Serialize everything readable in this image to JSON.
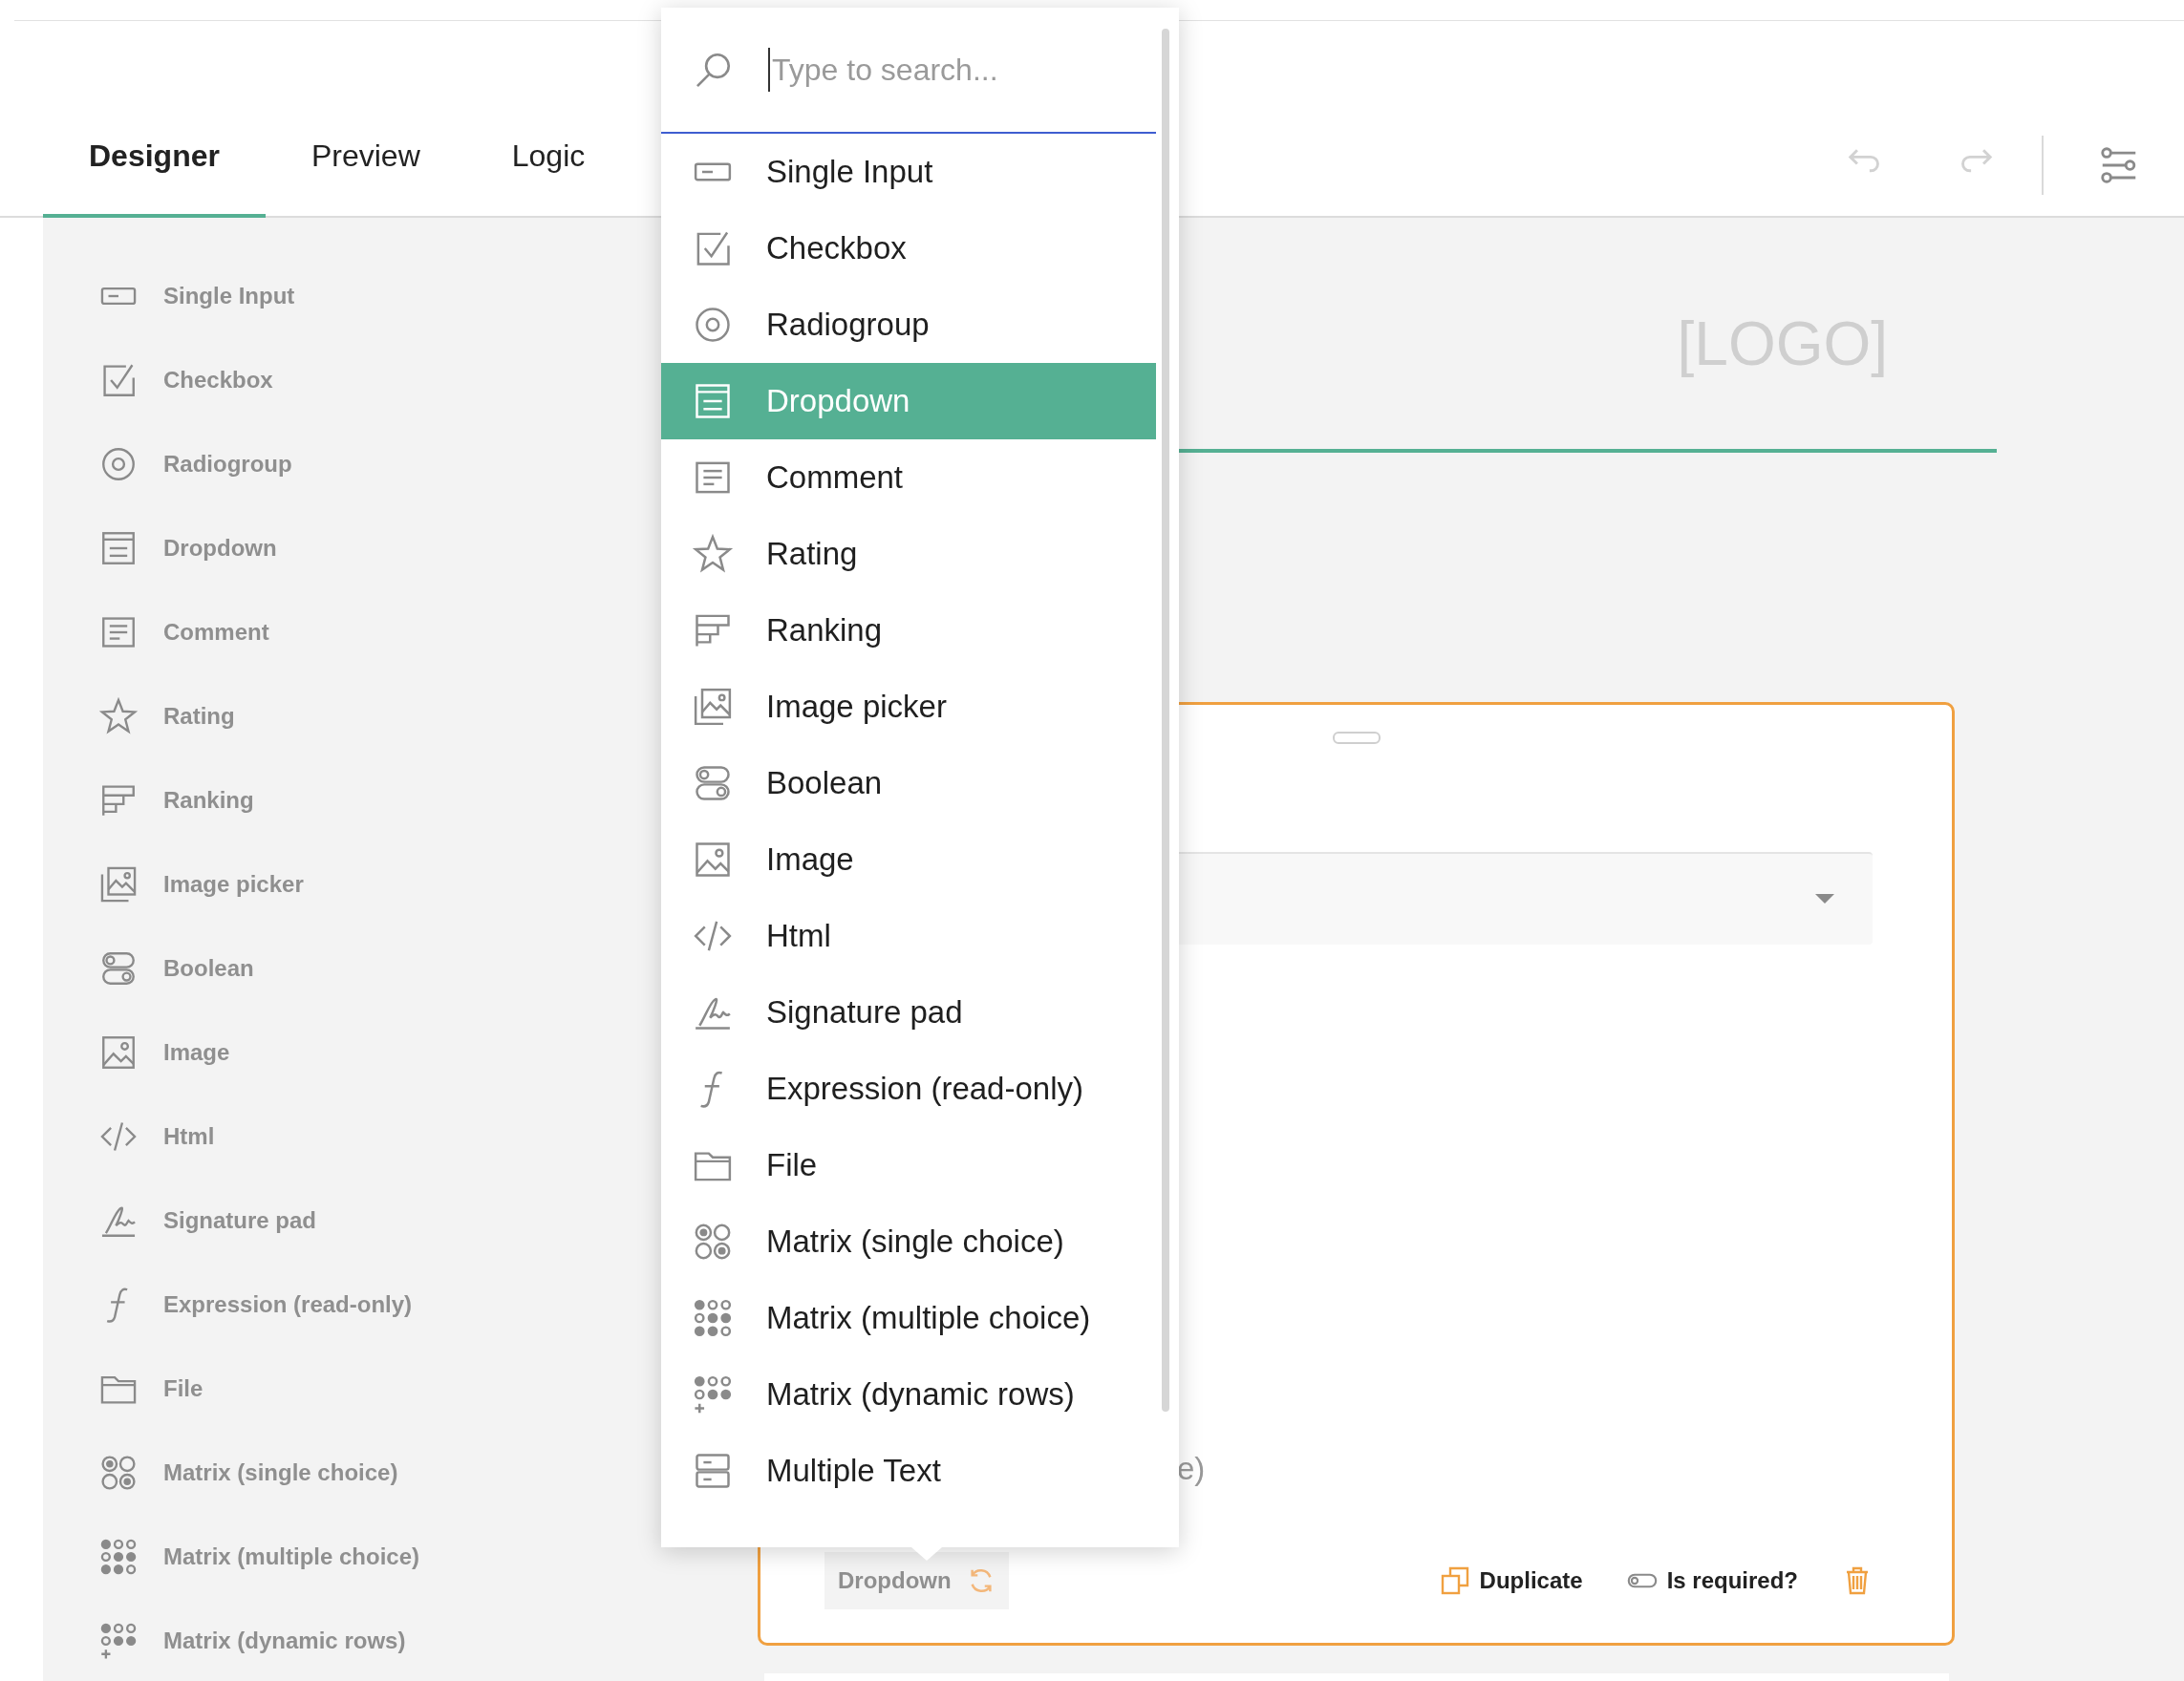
{
  "tabs": [
    {
      "label": "Designer",
      "selected": true
    },
    {
      "label": "Preview",
      "selected": false
    },
    {
      "label": "Logic",
      "selected": false
    }
  ],
  "toolbar": [
    {
      "kind": "undo",
      "disabled": true
    },
    {
      "kind": "redo",
      "disabled": true
    },
    {
      "kind": "settings",
      "disabled": false
    }
  ],
  "toolbox": {
    "items": [
      {
        "kind": "input",
        "label": "Single Input"
      },
      {
        "kind": "checkbox",
        "label": "Checkbox"
      },
      {
        "kind": "radio",
        "label": "Radiogroup"
      },
      {
        "kind": "dropdown",
        "label": "Dropdown"
      },
      {
        "kind": "comment",
        "label": "Comment"
      },
      {
        "kind": "rating",
        "label": "Rating"
      },
      {
        "kind": "ranking",
        "label": "Ranking"
      },
      {
        "kind": "imagepicker",
        "label": "Image picker"
      },
      {
        "kind": "boolean",
        "label": "Boolean"
      },
      {
        "kind": "image",
        "label": "Image"
      },
      {
        "kind": "html",
        "label": "Html"
      },
      {
        "kind": "signature",
        "label": "Signature pad"
      },
      {
        "kind": "expression",
        "label": "Expression (read-only)"
      },
      {
        "kind": "file",
        "label": "File"
      },
      {
        "kind": "matrix",
        "label": "Matrix (single choice)"
      },
      {
        "kind": "matrixmulti",
        "label": "Matrix (multiple choice)"
      },
      {
        "kind": "matrixdynamic",
        "label": "Matrix (dynamic rows)"
      }
    ]
  },
  "logo": "[LOGO]",
  "question": {
    "partial_text": "e)",
    "type_label": "Dropdown",
    "actions": [
      {
        "kind": "duplicate",
        "label": "Duplicate"
      },
      {
        "kind": "required",
        "label": "Is required?",
        "on": false
      },
      {
        "kind": "delete"
      }
    ]
  },
  "type_menu": {
    "search": {
      "placeholder": "Type to search..."
    },
    "items": [
      {
        "kind": "input",
        "label": "Single Input",
        "selected": false
      },
      {
        "kind": "checkbox",
        "label": "Checkbox",
        "selected": false
      },
      {
        "kind": "radio",
        "label": "Radiogroup",
        "selected": false
      },
      {
        "kind": "dropdown",
        "label": "Dropdown",
        "selected": true
      },
      {
        "kind": "comment",
        "label": "Comment",
        "selected": false
      },
      {
        "kind": "rating",
        "label": "Rating",
        "selected": false
      },
      {
        "kind": "ranking",
        "label": "Ranking",
        "selected": false
      },
      {
        "kind": "imagepicker",
        "label": "Image picker",
        "selected": false
      },
      {
        "kind": "boolean",
        "label": "Boolean",
        "selected": false
      },
      {
        "kind": "image",
        "label": "Image",
        "selected": false
      },
      {
        "kind": "html",
        "label": "Html",
        "selected": false
      },
      {
        "kind": "signature",
        "label": "Signature pad",
        "selected": false
      },
      {
        "kind": "expression",
        "label": "Expression (read-only)",
        "selected": false
      },
      {
        "kind": "file",
        "label": "File",
        "selected": false
      },
      {
        "kind": "matrix",
        "label": "Matrix (single choice)",
        "selected": false
      },
      {
        "kind": "matrixmulti",
        "label": "Matrix (multiple choice)",
        "selected": false
      },
      {
        "kind": "matrixdynamic",
        "label": "Matrix (dynamic rows)",
        "selected": false
      },
      {
        "kind": "multipletext",
        "label": "Multiple Text",
        "selected": false
      }
    ]
  }
}
